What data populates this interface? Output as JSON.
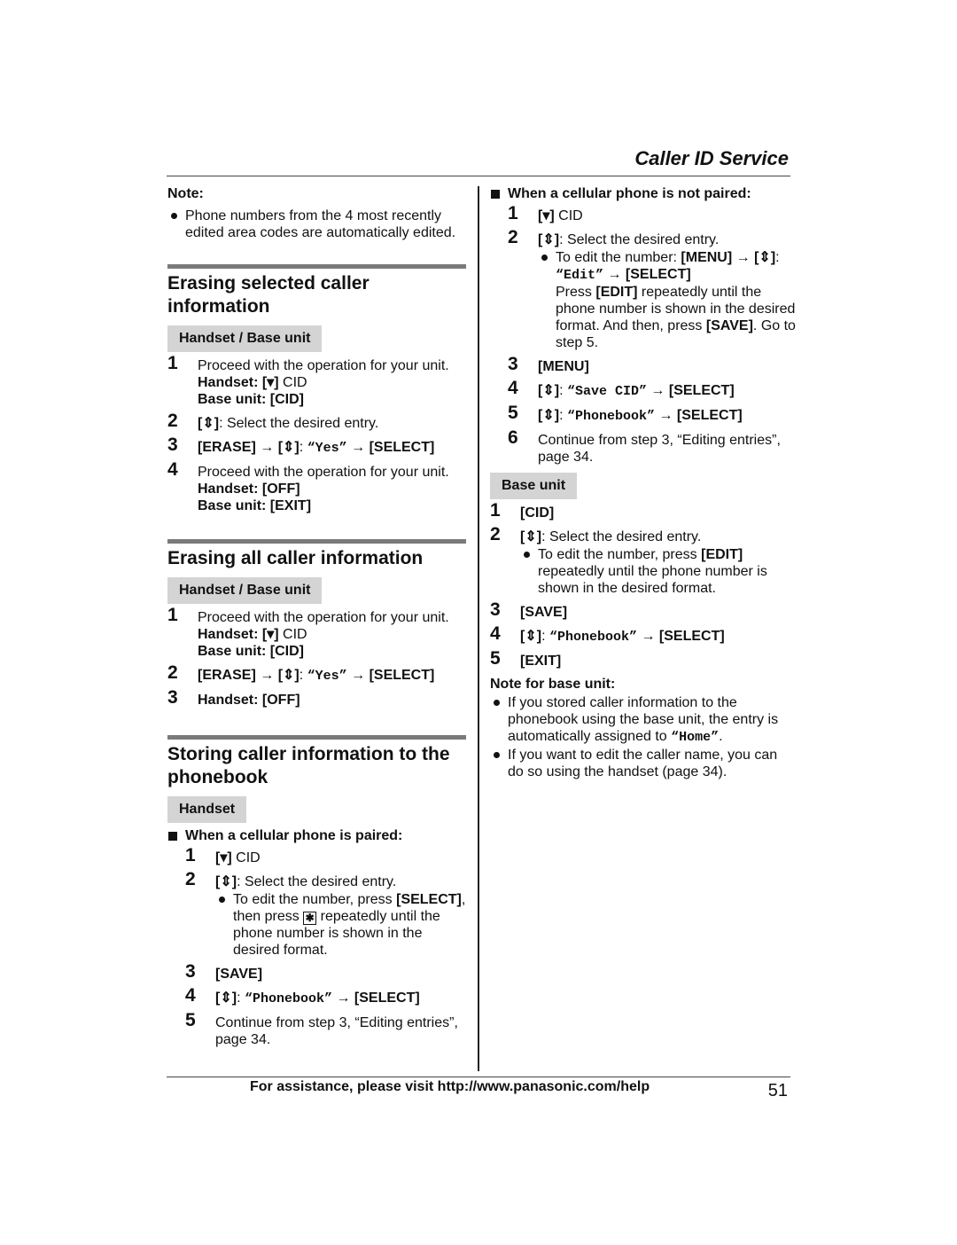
{
  "header": {
    "title": "Caller ID Service"
  },
  "footer": {
    "text": "For assistance, please visit http://www.panasonic.com/help",
    "page_number": "51"
  },
  "note": {
    "title": "Note:",
    "items": [
      "Phone numbers from the 4 most recently edited area codes are automatically edited."
    ]
  },
  "glyphs": {
    "down": "[▾]",
    "updown": "[⇕]",
    "arrow": "→",
    "star": "✱"
  },
  "section1": {
    "title": "Erasing selected caller information",
    "tag": "Handset / Base unit",
    "steps": [
      {
        "num": "1",
        "text": "Proceed with the operation for your unit.",
        "handset_label": "Handset:",
        "handset_key": "[▾]",
        "handset_text": "CID",
        "base_label": "Base unit:",
        "base_key": "[CID]"
      },
      {
        "num": "2",
        "key": "[⇕]",
        "text": ": Select the desired entry."
      },
      {
        "num": "3",
        "k1": "[ERASE]",
        "k2": "[⇕]",
        "value": "“Yes”",
        "k3": "[SELECT]"
      },
      {
        "num": "4",
        "text": "Proceed with the operation for your unit.",
        "handset_label": "Handset:",
        "handset_key": "[OFF]",
        "base_label": "Base unit:",
        "base_key": "[EXIT]"
      }
    ]
  },
  "section2": {
    "title": "Erasing all caller information",
    "tag": "Handset / Base unit",
    "steps": [
      {
        "num": "1",
        "text": "Proceed with the operation for your unit.",
        "handset_label": "Handset:",
        "handset_key": "[▾]",
        "handset_text": "CID",
        "base_label": "Base unit:",
        "base_key": "[CID]"
      },
      {
        "num": "2",
        "k1": "[ERASE]",
        "k2": "[⇕]",
        "value": "“Yes”",
        "k3": "[SELECT]"
      },
      {
        "num": "3",
        "handset_label": "Handset:",
        "handset_key": "[OFF]"
      }
    ]
  },
  "section3": {
    "title": "Storing caller information to the phonebook",
    "tag": "Handset",
    "paired": {
      "heading": "When a cellular phone is paired:",
      "steps": [
        {
          "num": "1",
          "key": "[▾]",
          "text": "CID"
        },
        {
          "num": "2",
          "key": "[⇕]",
          "text": ": Select the desired entry.",
          "bullet_pre": "To edit the number, press",
          "bullet_key": "[SELECT]",
          "bullet_mid": ", then press",
          "bullet_post": "repeatedly until the phone number is shown in the desired format."
        },
        {
          "num": "3",
          "key": "[SAVE]"
        },
        {
          "num": "4",
          "key": "[⇕]",
          "value": "“Phonebook”",
          "k3": "[SELECT]"
        },
        {
          "num": "5",
          "text": "Continue from step 3, “Editing entries”, page 34."
        }
      ]
    },
    "not_paired": {
      "heading": "When a cellular phone is not paired:",
      "steps": [
        {
          "num": "1",
          "key": "[▾]",
          "text": "CID"
        },
        {
          "num": "2",
          "key": "[⇕]",
          "text": ": Select the desired entry.",
          "bullet_pre": "To edit the number:",
          "bullet_k1": "[MENU]",
          "bullet_k2": "[⇕]",
          "bullet_value": "“Edit”",
          "bullet_k3": "[SELECT]",
          "press": "Press",
          "press_key": "[EDIT]",
          "press_text": "repeatedly until the phone number is shown in the desired format. And then, press",
          "save_key": "[SAVE]",
          "save_text": ". Go to step 5."
        },
        {
          "num": "3",
          "key": "[MENU]"
        },
        {
          "num": "4",
          "key": "[⇕]",
          "value": "“Save CID”",
          "k3": "[SELECT]"
        },
        {
          "num": "5",
          "key": "[⇕]",
          "value": "“Phonebook”",
          "k3": "[SELECT]"
        },
        {
          "num": "6",
          "text": "Continue from step 3, “Editing entries”, page 34."
        }
      ]
    },
    "base": {
      "tag": "Base unit",
      "steps": [
        {
          "num": "1",
          "key": "[CID]"
        },
        {
          "num": "2",
          "key": "[⇕]",
          "text": ": Select the desired entry.",
          "bullet_pre": "To edit the number, press",
          "bullet_key": "[EDIT]",
          "bullet_post": "repeatedly until the phone number is shown in the desired format."
        },
        {
          "num": "3",
          "key": "[SAVE]"
        },
        {
          "num": "4",
          "key": "[⇕]",
          "value": "“Phonebook”",
          "k3": "[SELECT]"
        },
        {
          "num": "5",
          "key": "[EXIT]"
        }
      ],
      "note_title": "Note for base unit:",
      "note_items": [
        {
          "pre": "If you stored caller information to the phonebook using the base unit, the entry is automatically assigned to",
          "value": "“Home”",
          "post": "."
        },
        {
          "text": "If you want to edit the caller name, you can do so using the handset (page 34)."
        }
      ]
    }
  }
}
